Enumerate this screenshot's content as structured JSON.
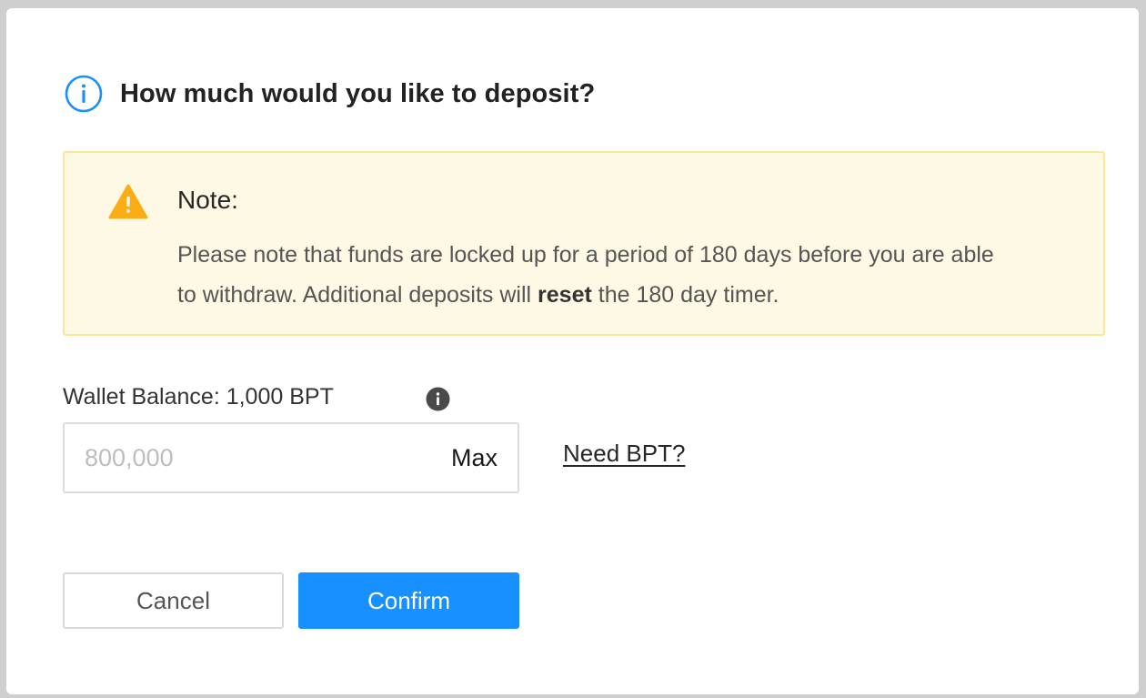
{
  "dialog": {
    "title": "How much would you like to deposit?",
    "title_icon": "info-circle-icon",
    "accent_color": "#1890ff"
  },
  "note": {
    "icon": "warning-triangle-icon",
    "icon_color": "#faad14",
    "title": "Note:",
    "body_before": "Please note that funds are locked up for a period of 180 days before you are able to withdraw. Additional deposits will ",
    "body_bold": "reset",
    "body_after": " the 180 day timer."
  },
  "balance": {
    "label": "Wallet Balance: 1,000 BPT",
    "info_icon": "info-filled-icon"
  },
  "amount_input": {
    "value": "",
    "placeholder": "800,000",
    "max_label": "Max"
  },
  "need_link": "Need BPT?",
  "buttons": {
    "cancel": "Cancel",
    "confirm": "Confirm"
  }
}
